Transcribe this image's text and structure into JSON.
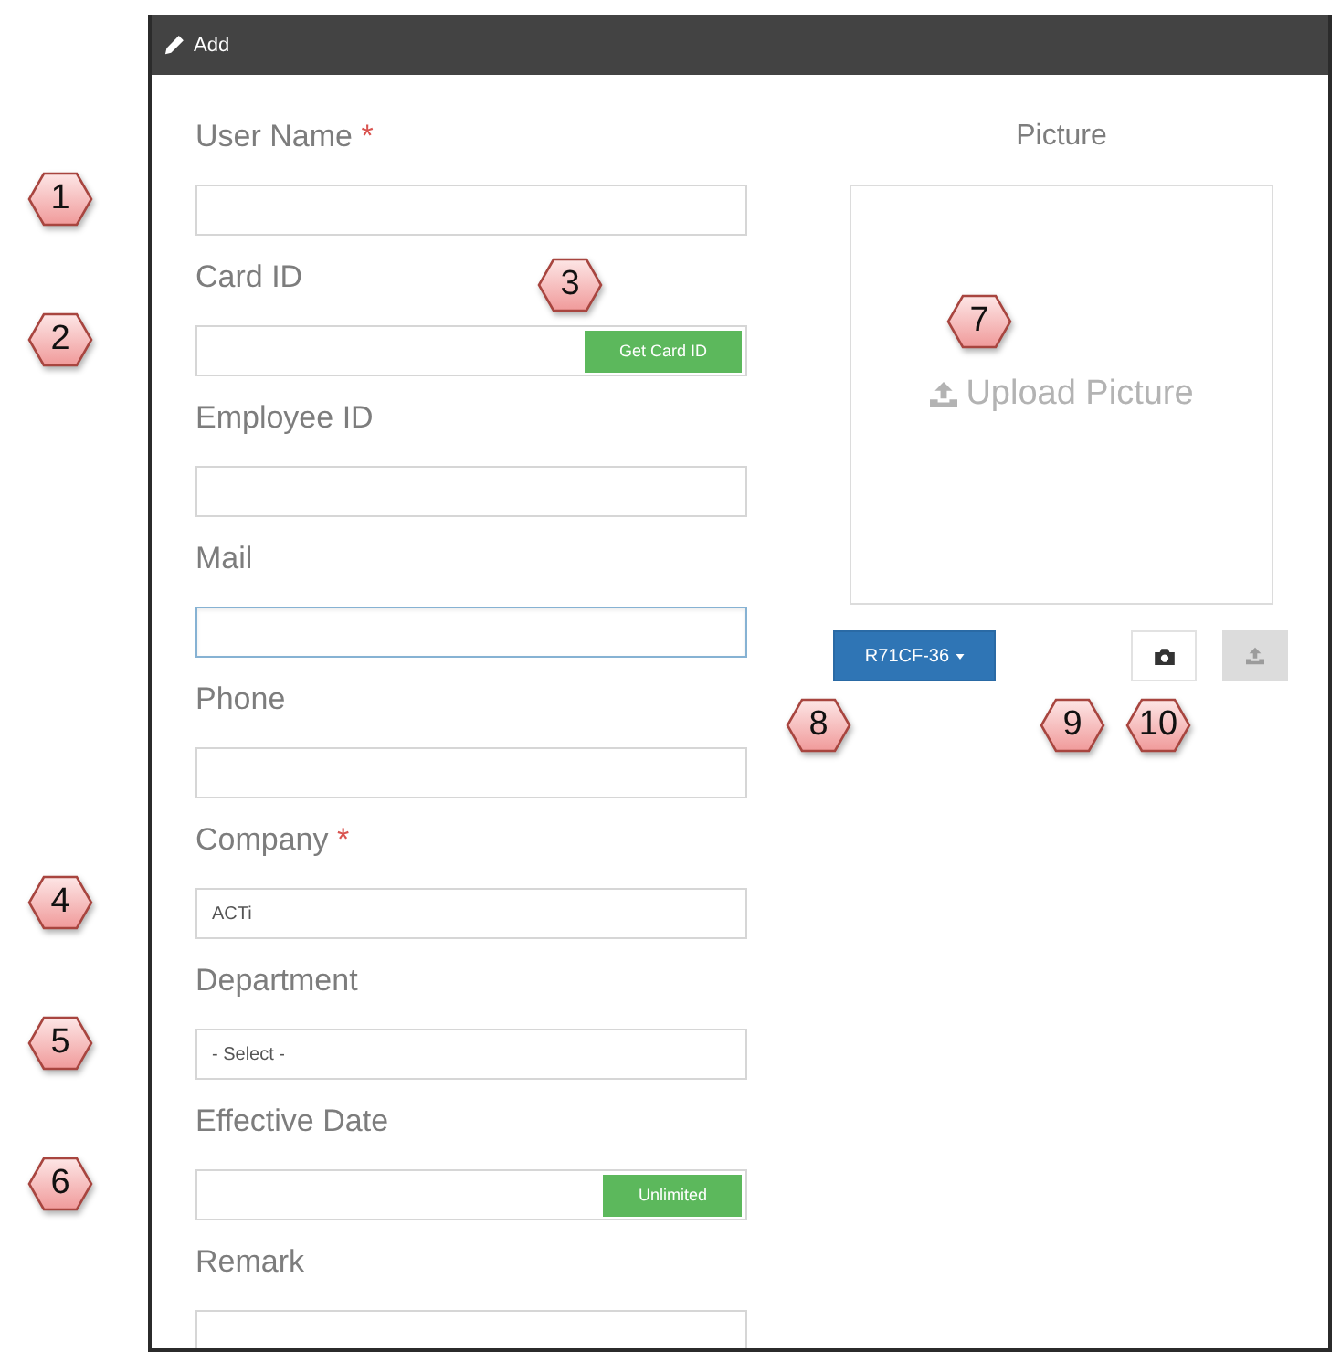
{
  "window": {
    "title": "Add"
  },
  "form": {
    "fields": [
      {
        "label": "User Name",
        "required_mark": "*",
        "kind": "text",
        "focused": false,
        "callout": "1"
      },
      {
        "label": "Card ID",
        "kind": "button",
        "button": {
          "label": "Get Card ID",
          "callout": "3"
        },
        "focused": false,
        "callout": "2"
      },
      {
        "label": "Employee ID",
        "kind": "text",
        "focused": false
      },
      {
        "label": "Mail",
        "kind": "text",
        "focused": true
      },
      {
        "label": "Phone",
        "kind": "text",
        "focused": false
      },
      {
        "label": "Company",
        "required_mark": "*",
        "kind": "text",
        "value": "ACTi",
        "focused": false,
        "callout": "4"
      },
      {
        "label": "Department",
        "kind": "select",
        "value": "- Select -",
        "focused": false,
        "callout": "5"
      },
      {
        "label": "Effective Date",
        "kind": "button",
        "button": {
          "label": "Unlimited"
        },
        "focused": false,
        "callout": "6"
      },
      {
        "label": "Remark",
        "kind": "text",
        "focused": false
      }
    ]
  },
  "picture": {
    "label": "Picture",
    "upload": {
      "label": "Upload Picture",
      "callout": "7"
    },
    "buttons": [
      {
        "kind": "dropdown",
        "label": "R71CF-36",
        "disabled": false
      },
      {
        "kind": "camera",
        "disabled": false
      },
      {
        "kind": "upload",
        "disabled": true
      }
    ],
    "callouts": [
      "8",
      "9",
      "10"
    ]
  }
}
